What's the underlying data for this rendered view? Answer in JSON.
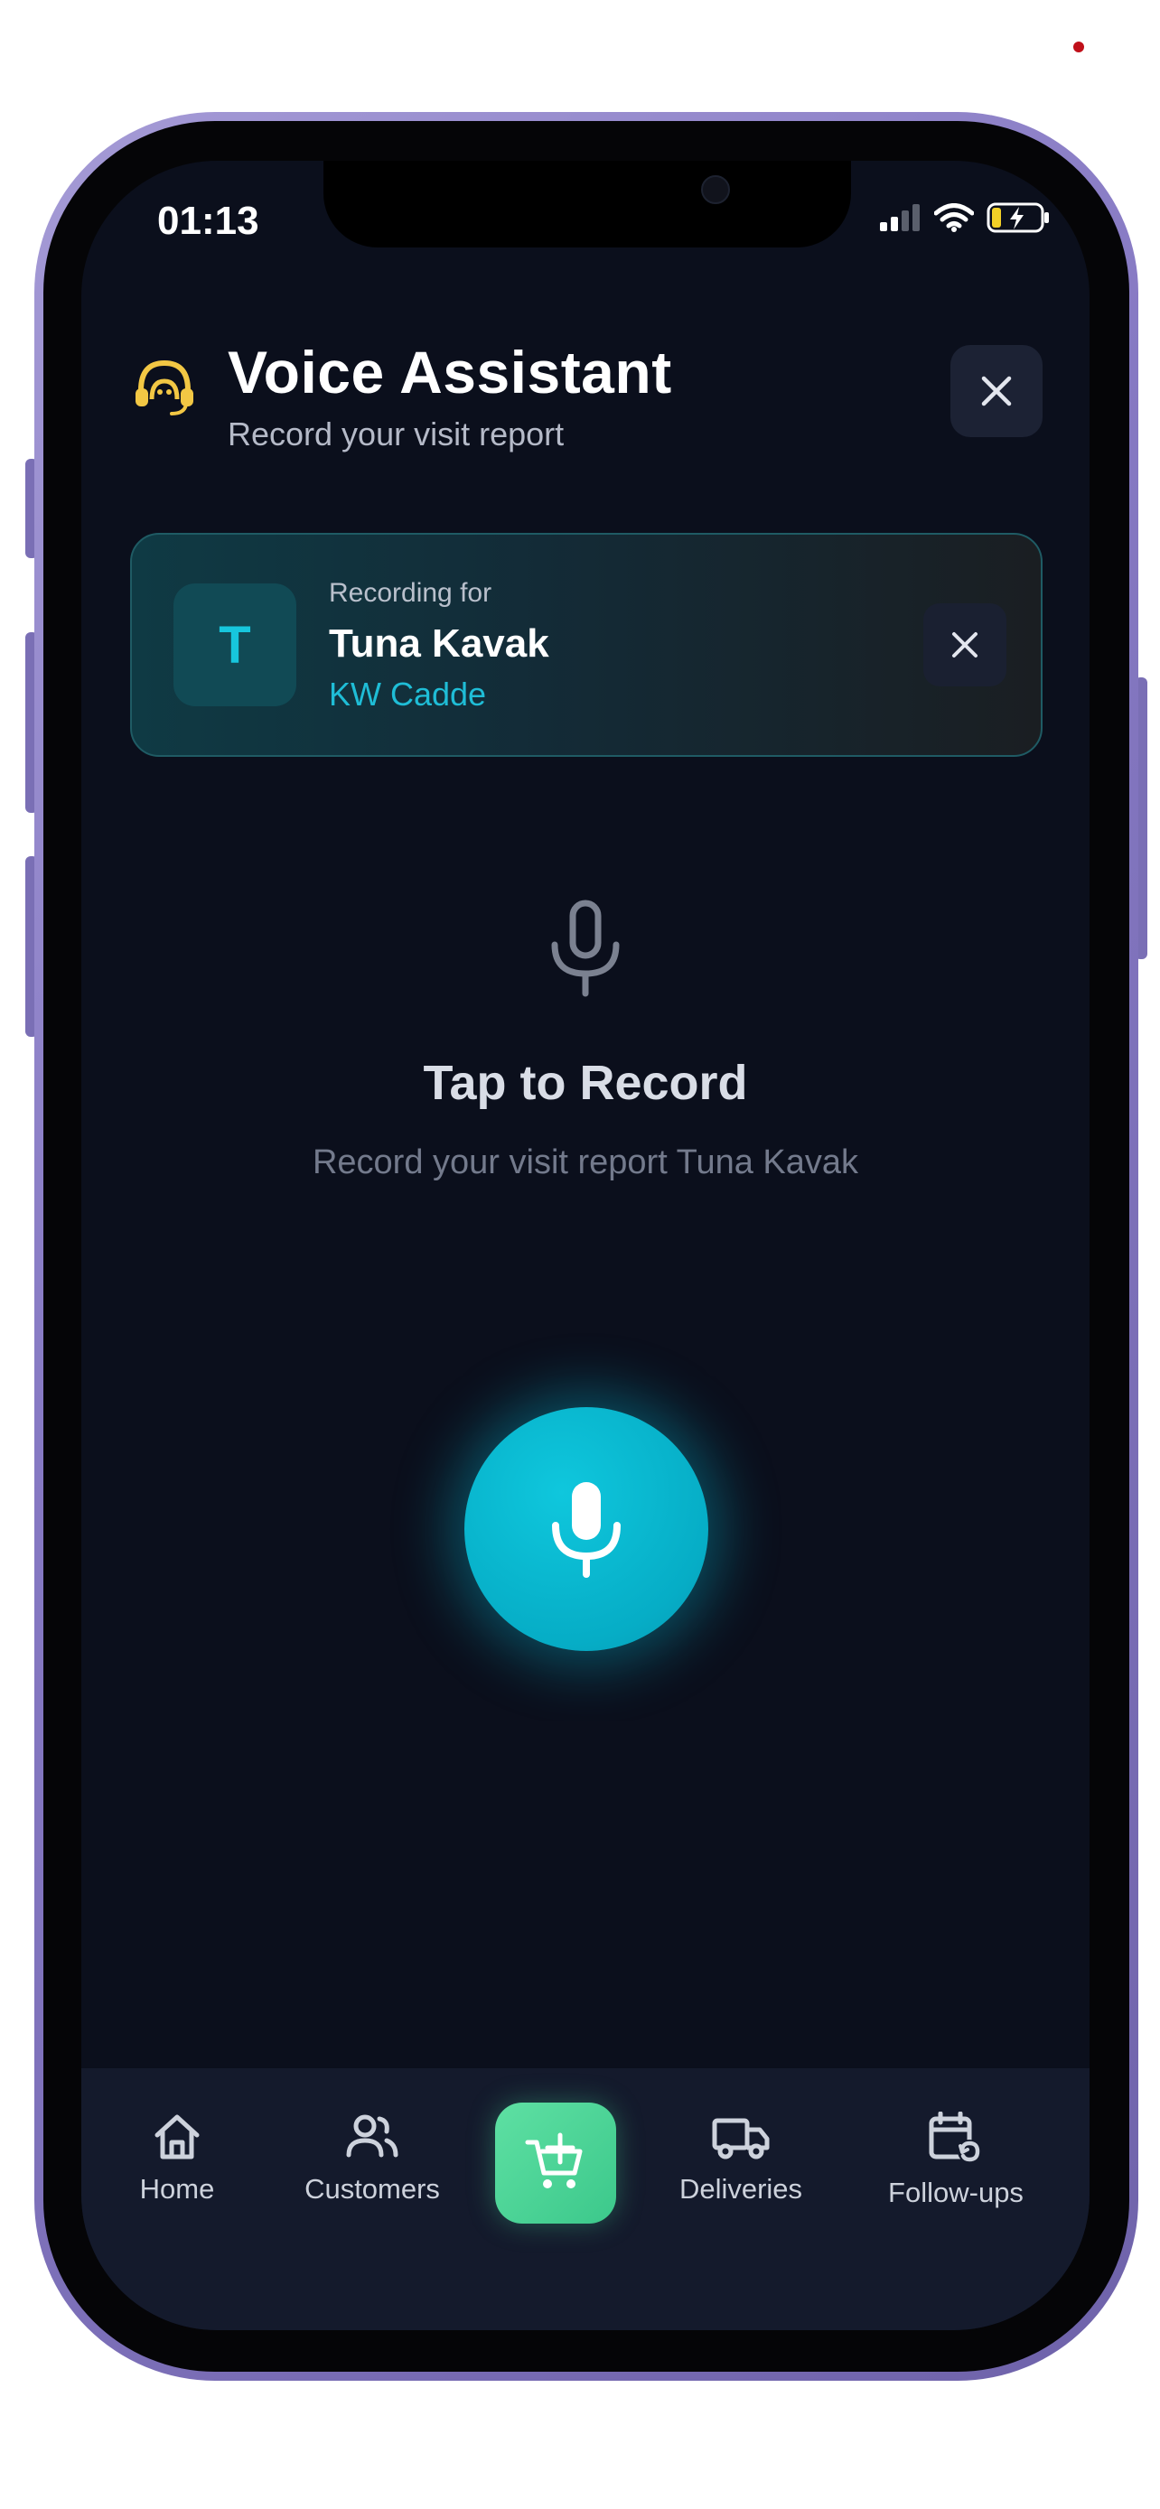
{
  "status_bar": {
    "time": "01:13"
  },
  "header": {
    "title": "Voice Assistant",
    "subtitle": "Record your visit report",
    "icon": "headset-icon",
    "close_icon": "close-icon"
  },
  "recording_card": {
    "avatar_initial": "T",
    "label": "Recording for",
    "customer_name": "Tuna Kavak",
    "company": "KW Cadde",
    "close_icon": "close-icon"
  },
  "empty_state": {
    "icon": "microphone-icon",
    "title": "Tap to Record",
    "subtitle": "Record your visit report Tuna Kavak"
  },
  "record_button": {
    "icon": "microphone-icon"
  },
  "bottom_nav": {
    "items": [
      {
        "label": "Home",
        "icon": "home-icon"
      },
      {
        "label": "Customers",
        "icon": "users-icon"
      },
      {
        "label": "",
        "icon": "cart-plus-icon"
      },
      {
        "label": "Deliveries",
        "icon": "truck-icon"
      },
      {
        "label": "Follow-ups",
        "icon": "calendar-refresh-icon"
      }
    ]
  },
  "colors": {
    "background": "#0b0f1c",
    "accent": "#06adc6",
    "accent_text": "#1fbdd6",
    "cart_button": "#4fd699",
    "headset_icon": "#f2c744",
    "nav_background": "#141a2c"
  }
}
